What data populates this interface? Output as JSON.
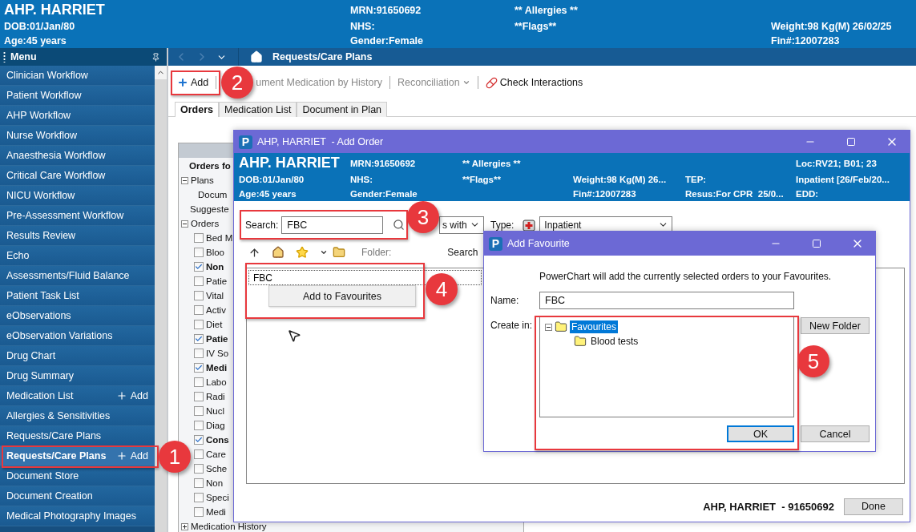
{
  "patient_banner": {
    "name": "AHP. HARRIET",
    "dob": "DOB:01/Jan/80",
    "age": "Age:45 years",
    "mrn": "MRN:91650692",
    "nhs": "NHS:",
    "gender": "Gender:Female",
    "allergies": "** Allergies **",
    "flags": "**Flags**",
    "weight": "Weight:98 Kg(M) 26/02/25",
    "fin": "Fin#:12007283"
  },
  "menu": {
    "title": "Menu",
    "items": [
      {
        "label": "Clinician Workflow",
        "selected": false
      },
      {
        "label": "Patient Workflow",
        "selected": false
      },
      {
        "label": "AHP Workflow",
        "selected": false
      },
      {
        "label": "Nurse Workflow",
        "selected": false
      },
      {
        "label": "Anaesthesia Workflow",
        "selected": false
      },
      {
        "label": "Critical Care Workflow",
        "selected": false
      },
      {
        "label": "NICU Workflow",
        "selected": false
      },
      {
        "label": "Pre-Assessment Workflow",
        "selected": false
      },
      {
        "label": "Results Review",
        "selected": false
      },
      {
        "label": "Echo",
        "selected": false
      },
      {
        "label": "Assessments/Fluid Balance",
        "selected": false
      },
      {
        "label": "Patient Task List",
        "selected": false
      },
      {
        "label": "eObservations",
        "selected": false
      },
      {
        "label": "eObservation Variations",
        "selected": false
      },
      {
        "label": "Drug Chart",
        "selected": false
      },
      {
        "label": "Drug Summary",
        "selected": false
      },
      {
        "label": "Medication List",
        "selected": false,
        "add_label": "Add"
      },
      {
        "label": "Allergies & Sensitivities",
        "selected": false
      },
      {
        "label": "Requests/Care Plans",
        "selected": false
      },
      {
        "label": "Requests/Care Plans",
        "selected": true,
        "add_label": "Add"
      },
      {
        "label": "Document Store",
        "selected": false
      },
      {
        "label": "Document Creation",
        "selected": false
      },
      {
        "label": "Medical Photography Images",
        "selected": false
      }
    ]
  },
  "nav_bar": {
    "title": "Requests/Care Plans"
  },
  "toolbar": [
    {
      "kind": "add",
      "label": "Add",
      "disabled": false
    },
    {
      "kind": "text",
      "label": "ument Medication by History",
      "disabled": true
    },
    {
      "kind": "dropdown",
      "label": "Reconciliation",
      "disabled": true
    },
    {
      "kind": "interactions",
      "label": "Check Interactions",
      "disabled": false
    }
  ],
  "tabs": [
    {
      "label": "Orders",
      "selected": true
    },
    {
      "label": "Medication List",
      "selected": false
    },
    {
      "label": "Document in Plan",
      "selected": false
    }
  ],
  "orders_tree": {
    "header": "Orders fo",
    "nodes": [
      {
        "kind": "group",
        "label": "Plans",
        "expanded": true,
        "children": [
          {
            "kind": "item",
            "label": "Docum"
          }
        ]
      },
      {
        "kind": "item",
        "label": "Suggeste"
      },
      {
        "kind": "group",
        "label": "Orders",
        "expanded": true,
        "children": [
          {
            "kind": "check",
            "label": "Bed M",
            "checked": false
          },
          {
            "kind": "check",
            "label": "Bloo",
            "checked": false
          },
          {
            "kind": "check",
            "label": "Non",
            "checked": true
          },
          {
            "kind": "check",
            "label": "Patie",
            "checked": false
          },
          {
            "kind": "check",
            "label": "Vital",
            "checked": false
          },
          {
            "kind": "check",
            "label": "Activ",
            "checked": false
          },
          {
            "kind": "check",
            "label": "Diet",
            "checked": false
          },
          {
            "kind": "check",
            "label": "Patie",
            "checked": true
          },
          {
            "kind": "check",
            "label": "IV So",
            "checked": false
          },
          {
            "kind": "check",
            "label": "Medi",
            "checked": true
          },
          {
            "kind": "check",
            "label": "Labo",
            "checked": false
          },
          {
            "kind": "check",
            "label": "Radi",
            "checked": false
          },
          {
            "kind": "check",
            "label": "Nucl",
            "checked": false
          },
          {
            "kind": "check",
            "label": "Diag",
            "checked": false
          },
          {
            "kind": "check",
            "label": "Cons",
            "checked": true
          },
          {
            "kind": "check",
            "label": "Care",
            "checked": false
          },
          {
            "kind": "check",
            "label": "Sche",
            "checked": false
          },
          {
            "kind": "check",
            "label": "Non",
            "checked": false
          },
          {
            "kind": "check",
            "label": "Speci",
            "checked": false
          },
          {
            "kind": "check",
            "label": "Medi",
            "checked": false
          }
        ]
      },
      {
        "kind": "group",
        "label": "Medication History",
        "expanded": false
      }
    ]
  },
  "add_order_dialog": {
    "app_icon": "P",
    "title": "AHP, HARRIET  - Add Order",
    "banner": {
      "name": "AHP. HARRIET",
      "dob": "DOB:01/Jan/80",
      "age": "Age:45 years",
      "mrn": "MRN:91650692",
      "nhs": "NHS:",
      "gender": "Gender:Female",
      "allergies": "** Allergies **",
      "flags": "**Flags**",
      "weight": "Weight:98 Kg(M) 26...",
      "fin": "Fin#:12007283",
      "tep": "TEP:",
      "resus": "Resus:For CPR  25/0...",
      "loc": "Loc:RV21; B01; 23",
      "encounter": "Inpatient [26/Feb/20...",
      "edd": "EDD:"
    },
    "search_label": "Search:",
    "search_value": "FBC",
    "search_mode": "s with",
    "type_label": "Type:",
    "type_value": "Inpatient",
    "folder_label": "Folder:",
    "column_label": "Search",
    "results": [
      "FBC"
    ],
    "context_menu": [
      "Add to Favourites"
    ],
    "footer_patient": "AHP, HARRIET  - 91650692",
    "done_label": "Done"
  },
  "add_favourite_dialog": {
    "app_icon": "P",
    "title": "Add Favourite",
    "message": "PowerChart will add the currently selected orders to your Favourites.",
    "name_label": "Name:",
    "name_value": "FBC",
    "create_in_label": "Create in:",
    "folders": [
      {
        "label": "Favourites",
        "selected": true,
        "expanded": true,
        "children": [
          {
            "label": "Blood tests",
            "selected": false
          }
        ]
      }
    ],
    "buttons": [
      {
        "kind": "new_folder",
        "label": "New Folder",
        "default": false
      },
      {
        "kind": "ok",
        "label": "OK",
        "default": true
      },
      {
        "kind": "cancel",
        "label": "Cancel",
        "default": false
      }
    ]
  },
  "callouts": [
    {
      "number": "1"
    },
    {
      "number": "2"
    },
    {
      "number": "3"
    },
    {
      "number": "4"
    },
    {
      "number": "5"
    }
  ]
}
